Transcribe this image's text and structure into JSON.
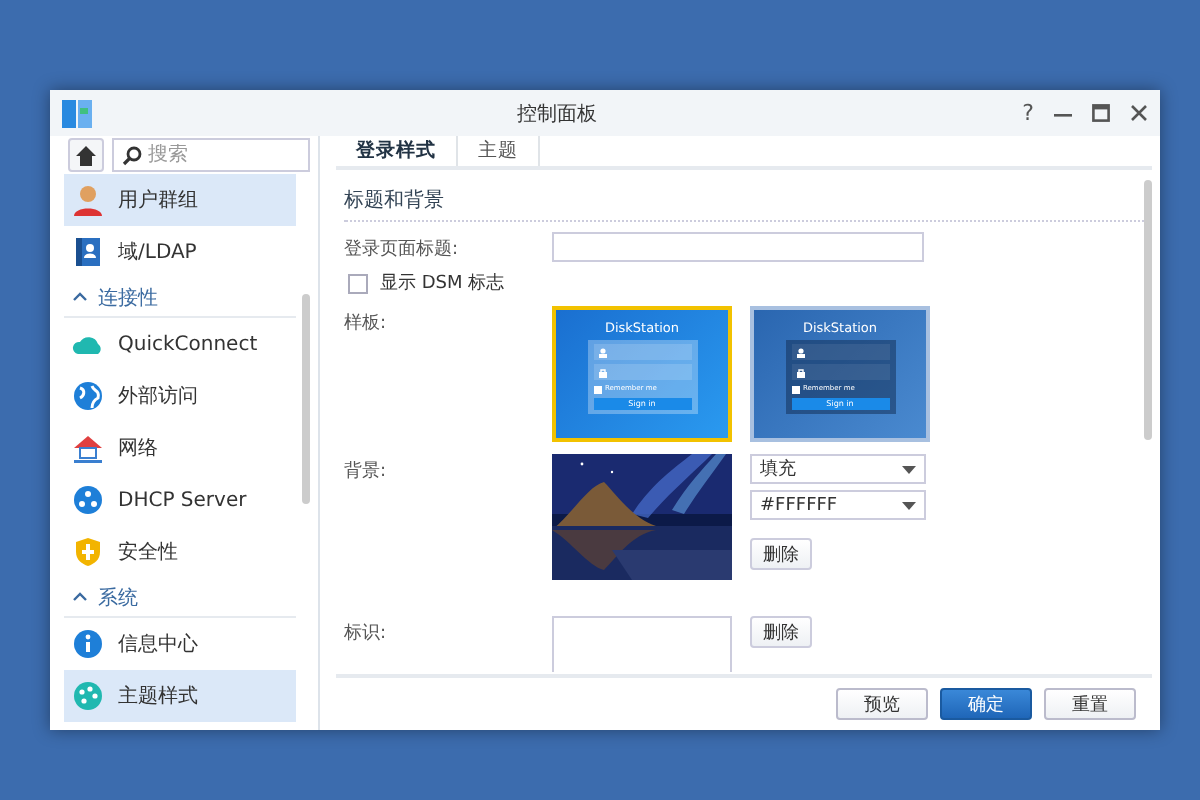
{
  "window": {
    "title": "控制面板",
    "help": "?"
  },
  "search": {
    "placeholder": "搜索"
  },
  "sidebar": {
    "items": [
      {
        "kind": "item",
        "label": "用户群组",
        "selected": true
      },
      {
        "kind": "item",
        "label": "域/LDAP",
        "selected": false
      },
      {
        "kind": "header",
        "label": "连接性",
        "expanded": true
      },
      {
        "kind": "item",
        "label": "QuickConnect",
        "selected": false
      },
      {
        "kind": "item",
        "label": "外部访问",
        "selected": false
      },
      {
        "kind": "item",
        "label": "网络",
        "selected": false
      },
      {
        "kind": "item",
        "label": "DHCP Server",
        "selected": false
      },
      {
        "kind": "item",
        "label": "安全性",
        "selected": false
      },
      {
        "kind": "header",
        "label": "系统",
        "expanded": true
      },
      {
        "kind": "item",
        "label": "信息中心",
        "selected": false
      },
      {
        "kind": "item",
        "label": "主题样式",
        "selected": true
      }
    ]
  },
  "tabs": [
    {
      "label": "登录样式",
      "selected": true
    },
    {
      "label": "主题",
      "selected": false
    }
  ],
  "section_title": "标题和背景",
  "login_title": {
    "label": "登录页面标题:"
  },
  "show_logo": {
    "label": "显示 DSM 标志",
    "checked": false
  },
  "templates": {
    "label": "样板:",
    "items": [
      {
        "kind": "bright",
        "title": "DiskStation",
        "remember": "Remember me",
        "button": "Sign in",
        "selected": true
      },
      {
        "kind": "deep",
        "title": "DiskStation",
        "remember": "Remember me",
        "button": "Sign in",
        "selected": false
      }
    ]
  },
  "background": {
    "label": "背景:",
    "mode": "填充",
    "fill_value": "#FFFFFF",
    "delete": "删除"
  },
  "logo": {
    "label": "标识:",
    "delete": "删除"
  },
  "footer_buttons": [
    {
      "label": "预览",
      "primary": false
    },
    {
      "label": "确定",
      "primary": true
    },
    {
      "label": "重置",
      "primary": false
    }
  ]
}
